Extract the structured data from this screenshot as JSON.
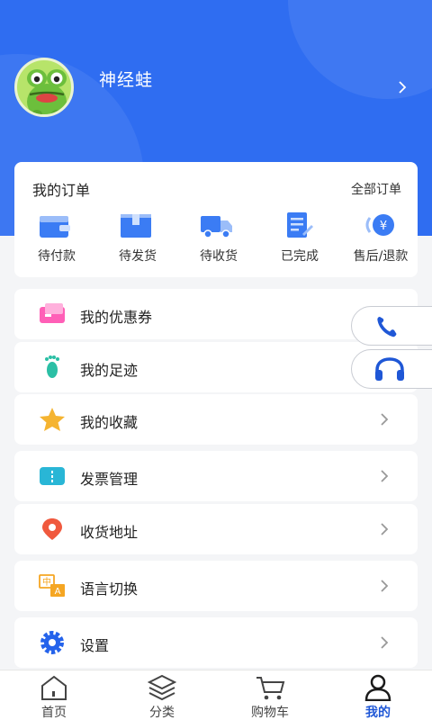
{
  "profile": {
    "username": "神经蛙"
  },
  "orders": {
    "title": "我的订单",
    "all_label": "全部订单",
    "items": [
      {
        "label": "待付款",
        "icon": "wallet-icon"
      },
      {
        "label": "待发货",
        "icon": "package-box-icon"
      },
      {
        "label": "待收货",
        "icon": "delivery-truck-icon"
      },
      {
        "label": "已完成",
        "icon": "completed-document-icon"
      },
      {
        "label": "售后/退款",
        "icon": "refund-yen-icon"
      }
    ]
  },
  "menu": [
    {
      "label": "我的优惠券",
      "icon": "coupon-icon"
    },
    {
      "label": "我的足迹",
      "icon": "footprint-icon"
    },
    {
      "label": "我的收藏",
      "icon": "star-icon"
    },
    {
      "label": "发票管理",
      "icon": "invoice-ticket-icon"
    },
    {
      "label": "收货地址",
      "icon": "location-pin-icon"
    },
    {
      "label": "语言切换",
      "icon": "language-icon"
    },
    {
      "label": "设置",
      "icon": "gear-icon"
    }
  ],
  "floating": [
    {
      "name": "phone",
      "icon": "phone-icon"
    },
    {
      "name": "customer-service",
      "icon": "headphones-icon"
    }
  ],
  "tabbar": {
    "items": [
      {
        "label": "首页",
        "icon": "home-icon"
      },
      {
        "label": "分类",
        "icon": "layers-icon"
      },
      {
        "label": "购物车",
        "icon": "cart-icon"
      },
      {
        "label": "我的",
        "icon": "user-icon",
        "active": true
      }
    ]
  },
  "colors": {
    "header_blue": "#2f6df1",
    "icon_blue": "#3b7cf4",
    "active_tab": "#1f57d6"
  }
}
